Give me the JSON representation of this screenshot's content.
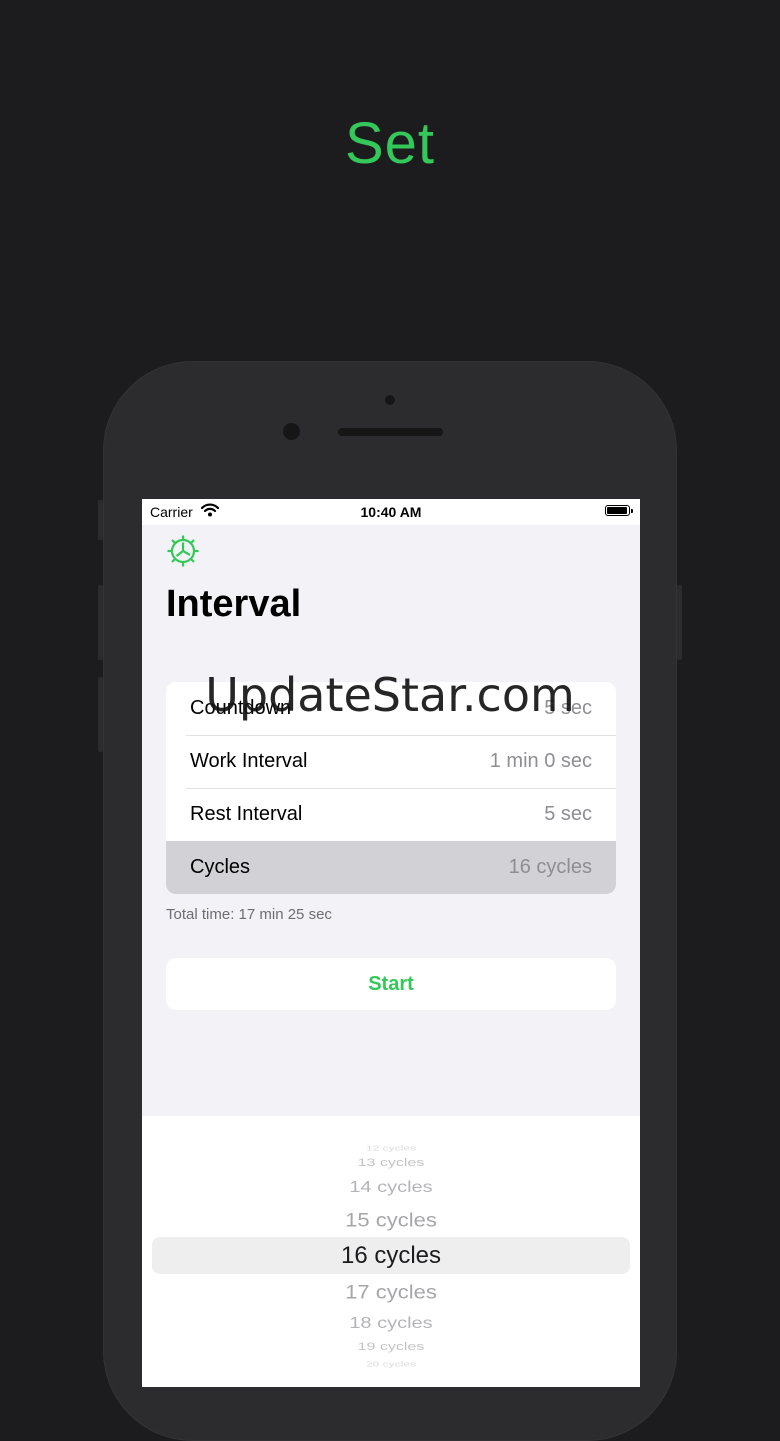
{
  "headline": "Set",
  "status_bar": {
    "carrier": "Carrier",
    "time": "10:40 AM"
  },
  "nav": {
    "title": "Interval",
    "settings_icon": "gear-icon"
  },
  "intervals": [
    {
      "label": "Countdown",
      "value": "5 sec"
    },
    {
      "label": "Work Interval",
      "value": "1 min 0 sec"
    },
    {
      "label": "Rest Interval",
      "value": "5 sec"
    },
    {
      "label": "Cycles",
      "value": "16 cycles"
    }
  ],
  "selected_row": 3,
  "total_time": "Total time: 17 min 25 sec",
  "start_label": "Start",
  "picker": {
    "items": [
      "12 cycles",
      "13 cycles",
      "14 cycles",
      "15 cycles",
      "16 cycles",
      "17 cycles",
      "18 cycles",
      "19 cycles",
      "20 cycles"
    ],
    "selected": "16 cycles"
  },
  "watermark": "UpdateStar.com",
  "colors": {
    "accent": "#34c759",
    "background": "#1c1c1e",
    "screen_bg": "#f2f2f7"
  }
}
